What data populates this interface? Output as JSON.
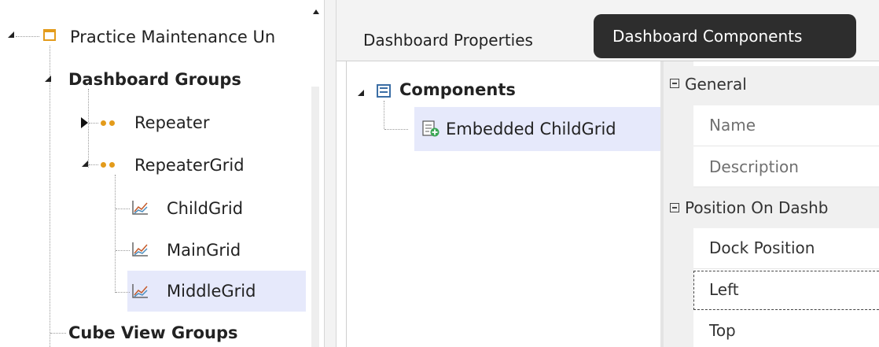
{
  "left_tree": {
    "root_label": "Practice Maintenance Un",
    "dashboard_groups_label": "Dashboard Groups",
    "repeater_label": "Repeater",
    "repeater_grid_label": "RepeaterGrid",
    "child_grid_label": "ChildGrid",
    "main_grid_label": "MainGrid",
    "middle_grid_label": "MiddleGrid",
    "cube_view_groups_label": "Cube View Groups"
  },
  "tabs": {
    "dashboard_properties": "Dashboard Properties",
    "dashboard_components": "Dashboard Components"
  },
  "components_tree": {
    "root_label": "Components",
    "item_label": "Embedded ChildGrid"
  },
  "properties": {
    "general_header": "General",
    "name_label": "Name",
    "description_label": "Description",
    "position_header": "Position On Dashb",
    "dock_position_label": "Dock Position",
    "left_label": "Left",
    "top_label": "Top"
  },
  "colors": {
    "accent_orange": "#e39b1b",
    "selection_bg": "#e6e9fb",
    "active_tab_bg": "#2d2d2d"
  }
}
